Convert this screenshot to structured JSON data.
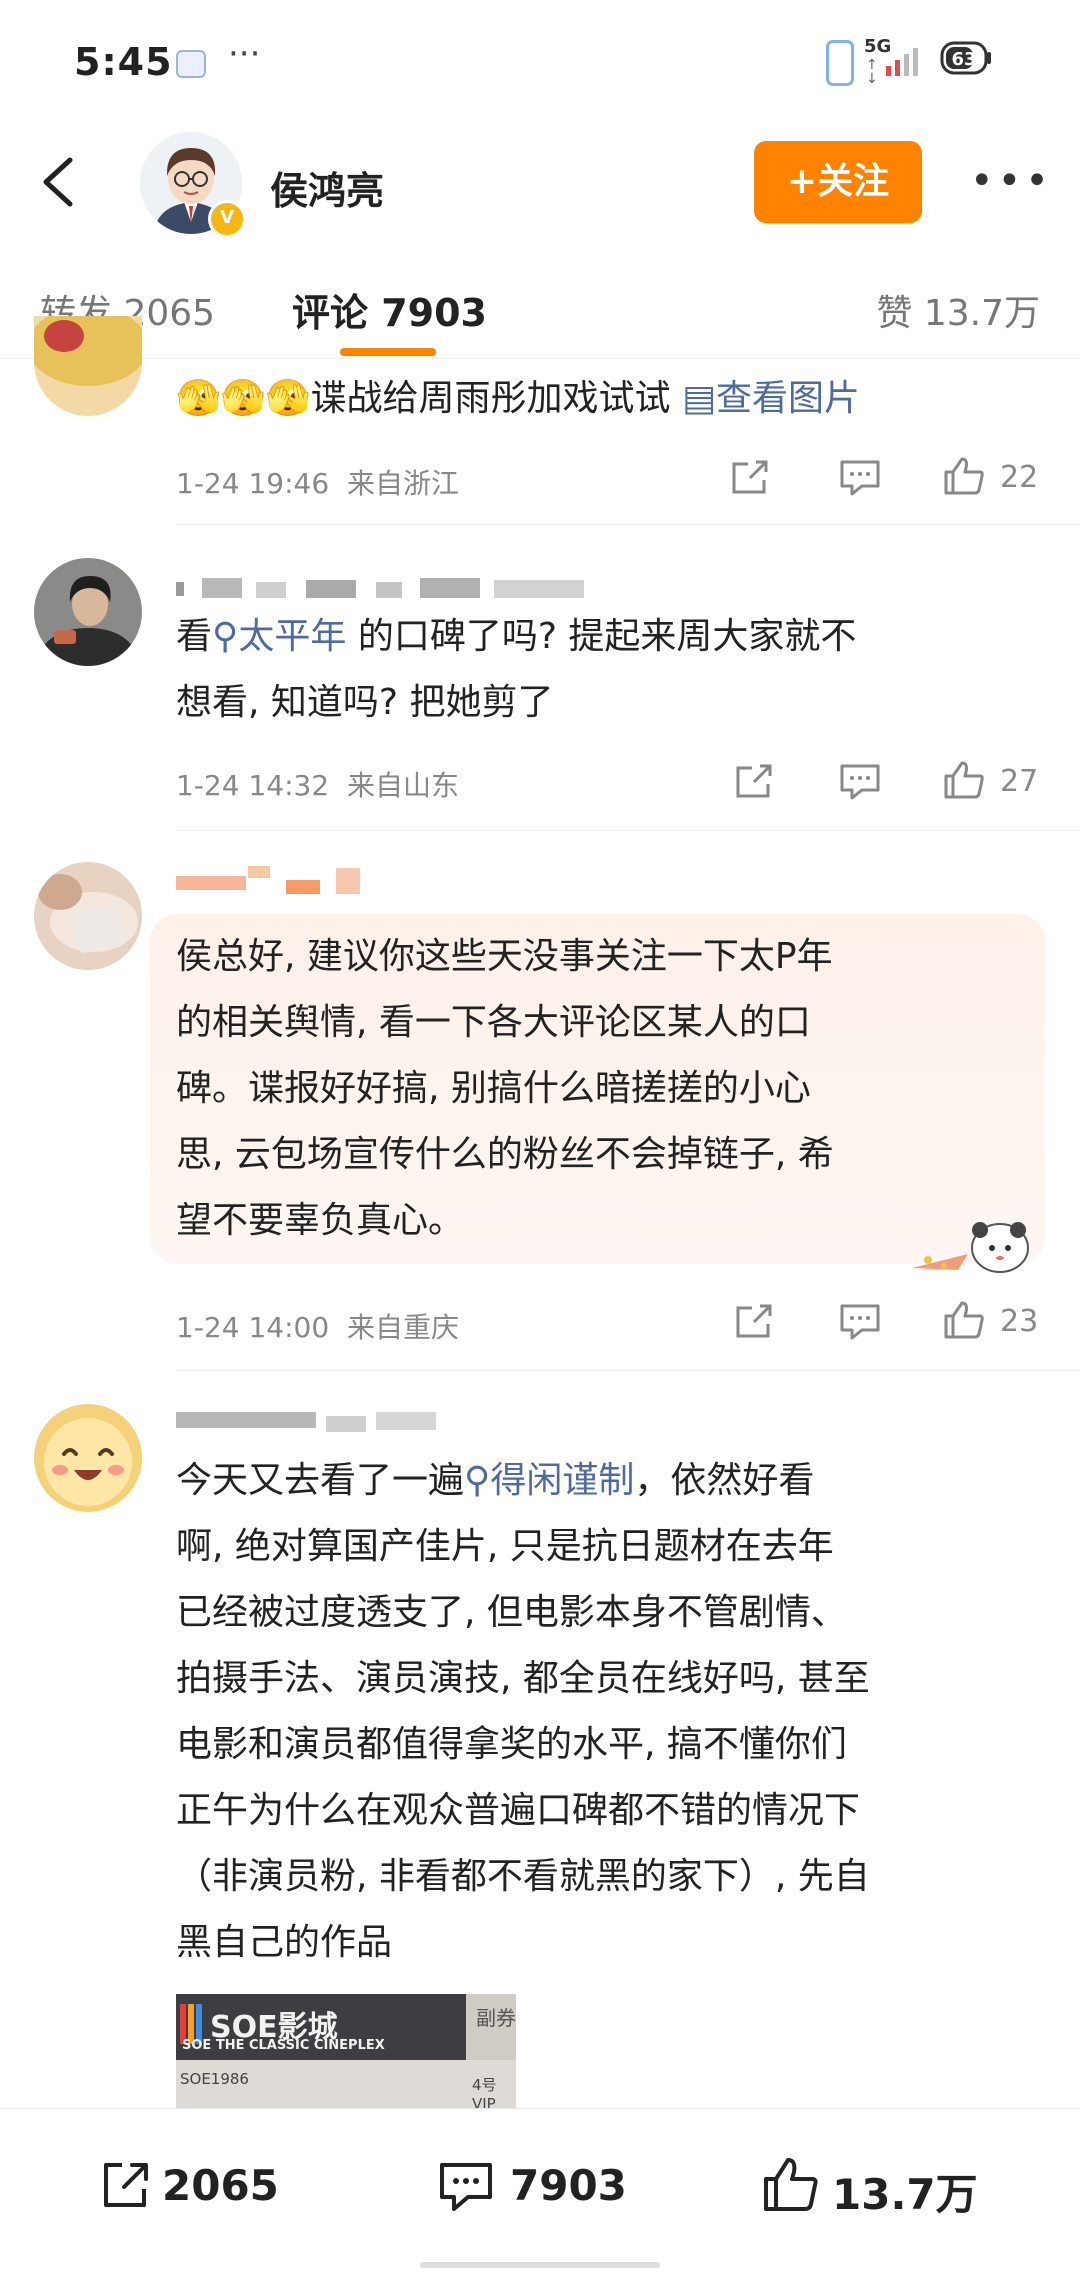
{
  "status_bar": {
    "time": "5:45",
    "overflow": "···",
    "network": "5G",
    "battery_level": "63",
    "icons": [
      "app-notification-icon",
      "phone-icon",
      "signal-icon",
      "battery-icon"
    ]
  },
  "header": {
    "author_name": "侯鸿亮",
    "verified_badge": "V",
    "follow_button": "+关注",
    "icons": [
      "back-icon",
      "more-icon"
    ],
    "accent_color": "#ff8200"
  },
  "tabs": {
    "repost": "转发 2065",
    "comments": "评论 7903",
    "likes": "赞 13.7万",
    "active": "comments"
  },
  "comments": [
    {
      "emoji": "🫣🫣🫣",
      "text": "谍战给周雨彤加戏试试",
      "image_link": "查看图片",
      "time": "1-24 19:46",
      "location": "来自浙江",
      "likes": "22"
    },
    {
      "text_prefix": "看",
      "topic": "太平年",
      "text_rest": " 的口碑了吗? 提起来周大家就不",
      "text_line2": "想看, 知道吗? 把她剪了",
      "time": "1-24 14:32",
      "location": "来自山东",
      "likes": "27"
    },
    {
      "lines": [
        "侯总好, 建议你这些天没事关注一下太P年",
        "的相关舆情, 看一下各大评论区某人的口",
        "碑。谍报好好搞, 别搞什么暗搓搓的小心",
        "思, 云包场宣传什么的粉丝不会掉链子, 希",
        "望不要辜负真心。"
      ],
      "time": "1-24 14:00",
      "location": "来自重庆",
      "likes": "23"
    },
    {
      "line1_prefix": "今天又去看了一遍",
      "topic": "得闲谨制",
      "line1_suffix": "，依然好看",
      "lines": [
        "啊, 绝对算国产佳片, 只是抗日题材在去年",
        "已经被过度透支了, 但电影本身不管剧情、",
        "拍摄手法、演员演技, 都全员在线好吗, 甚至",
        "电影和演员都值得拿奖的水平, 搞不懂你们",
        "正午为什么在观众普遍口碑都不错的情况下",
        "（非演员粉, 非看都不看就黑的家下）, 先自",
        "黑自己的作品"
      ],
      "ticket": {
        "brand": "SOE影城",
        "subtitle": "SOE THE CLASSIC CINEPLEX",
        "code": "SOE1986",
        "hall": "4号VIP",
        "stub": "副券"
      }
    }
  ],
  "bottom_bar": {
    "repost": "2065",
    "comments": "7903",
    "likes": "13.7万"
  }
}
